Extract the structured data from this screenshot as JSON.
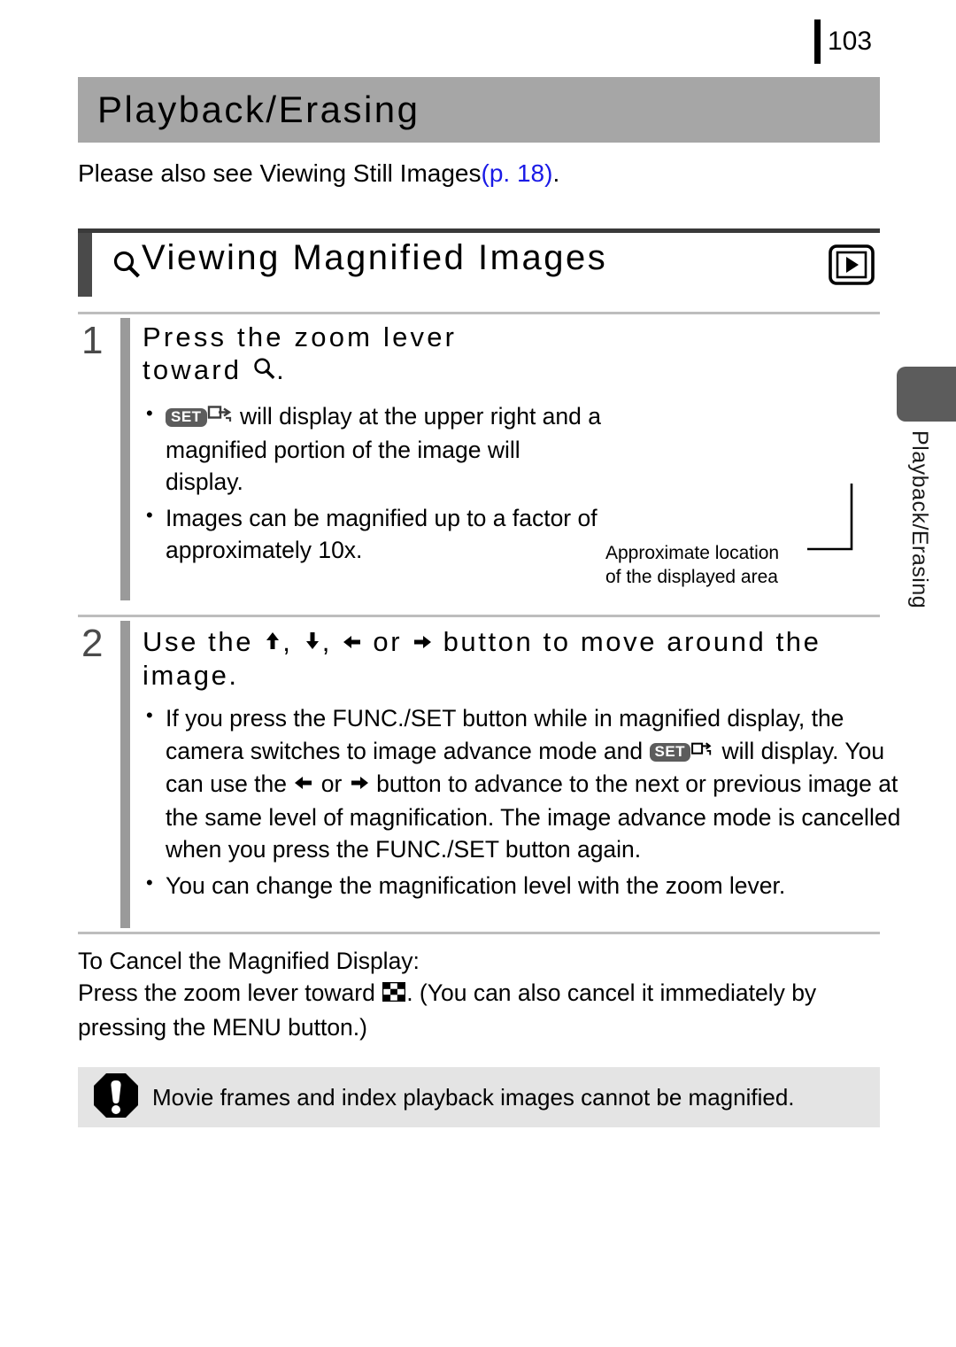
{
  "page": {
    "number": "103",
    "chapter_title": "Playback/Erasing",
    "intro_prefix": "Please also see Viewing Still Images",
    "intro_link": "(p. 18)",
    "intro_suffix": ".",
    "link_color": "#1a1ae6",
    "band_color": "#a6a6a6",
    "accent_color": "#4a4a4a",
    "note_bg_color": "#e4e4e4",
    "side_tab_color": "#5c5c5c"
  },
  "section": {
    "icon": "magnifier-icon",
    "title": "Viewing Magnified Images",
    "mode_icon": "playback-mode-icon"
  },
  "steps": [
    {
      "number": "1",
      "heading_line1": "Press the zoom lever",
      "heading_line2_prefix": "toward",
      "heading_line2_icon": "magnifier-icon",
      "heading_line2_suffix": ".",
      "bullets": [
        {
          "icon_set": "set-badge-icon",
          "icon_advance": "image-advance-icon",
          "text": "will display at the upper right and a magnified portion of the image will display."
        },
        {
          "text": "Images can be magnified up to a factor of approximately 10x."
        }
      ]
    },
    {
      "number": "2",
      "heading_prefix": "Use the",
      "heading_icons": [
        "up-arrow-icon",
        "down-arrow-icon",
        "left-arrow-icon",
        "right-arrow-icon"
      ],
      "heading_sep1": ",",
      "heading_sep2": ",",
      "heading_or": "or",
      "heading_suffix": "button to move around the image.",
      "bullets": [
        {
          "text_part1": "If you press the FUNC./SET button while in magnified display, the camera switches to image advance mode and",
          "icon_set": "set-badge-icon",
          "icon_advance": "image-advance-icon",
          "text_part2": "will display. You can use the",
          "icon_left": "left-arrow-icon",
          "text_or": "or",
          "icon_right": "right-arrow-icon",
          "text_part3": "button to advance to the next or previous image at the same level of magnification. The image advance mode is cancelled when you press the FUNC./SET button again."
        },
        {
          "text": "You can change the magnification level with the zoom lever."
        }
      ]
    }
  ],
  "callout": {
    "line1": "Approximate location",
    "line2": "of the displayed area"
  },
  "cancel_section": {
    "heading": "To Cancel the Magnified Display:",
    "text_part1": "Press the zoom lever toward",
    "index_icon": "index-playback-icon",
    "text_part2": ". (You can also cancel it immediately by pressing the MENU button.)"
  },
  "note": {
    "icon": "warning-exclamation-icon",
    "text": "Movie frames and index playback images cannot be magnified."
  },
  "side_tab": {
    "label": "Playback/Erasing"
  }
}
